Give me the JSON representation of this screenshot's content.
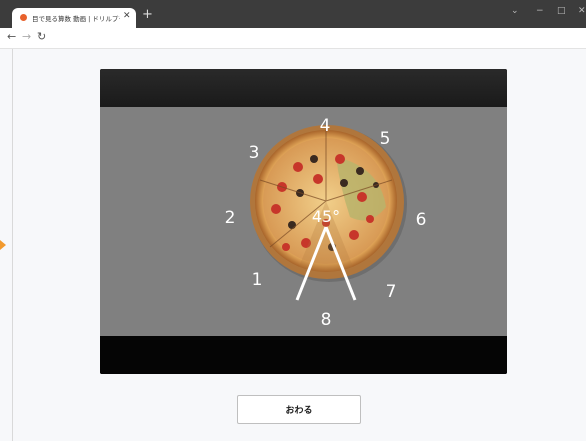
{
  "browser": {
    "tab_title": "目で見る算数 動画 | ドリルプラネット",
    "tab_close_icon": "close-icon",
    "new_tab_icon": "plus-icon",
    "nav_icons": [
      "back-arrow-icon",
      "forward-arrow-icon",
      "reload-icon"
    ],
    "window_controls": [
      "chevron-down-icon",
      "minimize-icon",
      "maximize-icon",
      "close-icon"
    ]
  },
  "video": {
    "clock_numbers": [
      "1",
      "2",
      "3",
      "4",
      "5",
      "6",
      "7",
      "8"
    ],
    "angle_label": "45°",
    "colors": {
      "stage": "#808080",
      "frame": "#0d0d0d",
      "crust": "#c98a3c",
      "sauce": "#d24a2a"
    }
  },
  "actions": {
    "finish_label": "おわる"
  }
}
